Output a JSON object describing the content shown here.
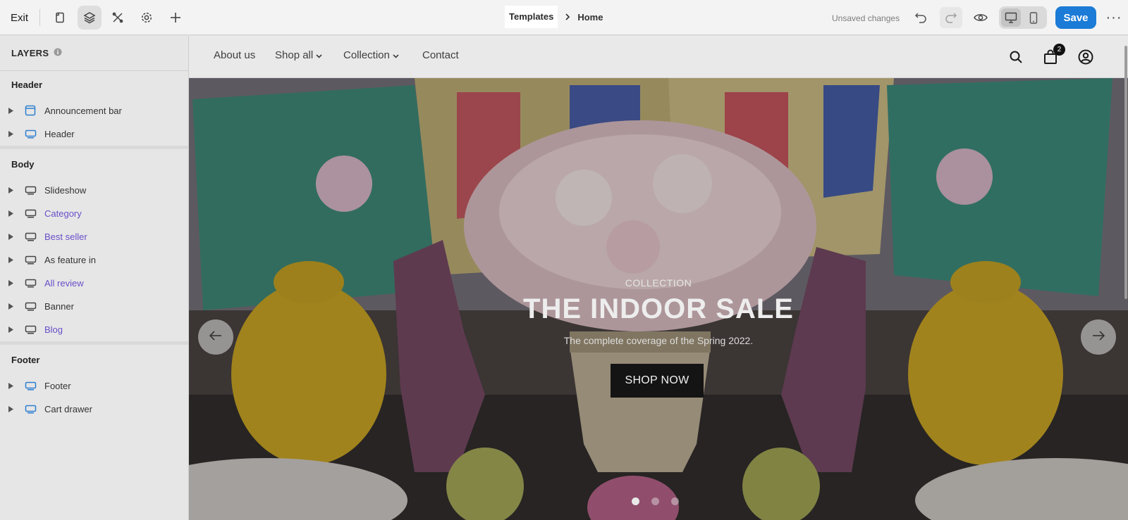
{
  "toolbar": {
    "exit_label": "Exit",
    "icons": [
      "pages-icon",
      "layers-icon",
      "tools-icon",
      "settings-icon",
      "add-icon"
    ],
    "breadcrumb": {
      "templates": "Templates",
      "home": "Home"
    },
    "status": "Unsaved changes",
    "save_label": "Save",
    "more_label": "···",
    "accent_color": "#1b7bd6"
  },
  "sidebar": {
    "title": "LAYERS",
    "sections": [
      {
        "title": "Header",
        "items": [
          {
            "label": "Announcement bar",
            "icon": "announcement-icon"
          },
          {
            "label": "Header",
            "icon": "section-icon"
          }
        ]
      },
      {
        "title": "Body",
        "items": [
          {
            "label": "Slideshow",
            "icon": "section-icon"
          },
          {
            "label": "Category",
            "icon": "section-icon"
          },
          {
            "label": "Best seller",
            "icon": "section-icon"
          },
          {
            "label": "As feature in",
            "icon": "section-icon"
          },
          {
            "label": "All review",
            "icon": "section-icon"
          },
          {
            "label": "Banner",
            "icon": "section-icon"
          },
          {
            "label": "Blog",
            "icon": "section-icon"
          }
        ]
      },
      {
        "title": "Footer",
        "items": [
          {
            "label": "Footer",
            "icon": "section-icon"
          },
          {
            "label": "Cart drawer",
            "icon": "section-icon"
          }
        ]
      }
    ],
    "link_color": "#6a4fc9"
  },
  "site": {
    "nav": {
      "about": "About us",
      "shop_all": "Shop all",
      "collection": "Collection",
      "contact": "Contact",
      "cart_count": "2"
    },
    "hero": {
      "kicker": "COLLECTION",
      "headline": "THE INDOOR SALE",
      "subline": "The complete coverage of the Spring 2022.",
      "cta": "SHOP NOW",
      "slide_count": 3,
      "active_slide": 1
    }
  }
}
